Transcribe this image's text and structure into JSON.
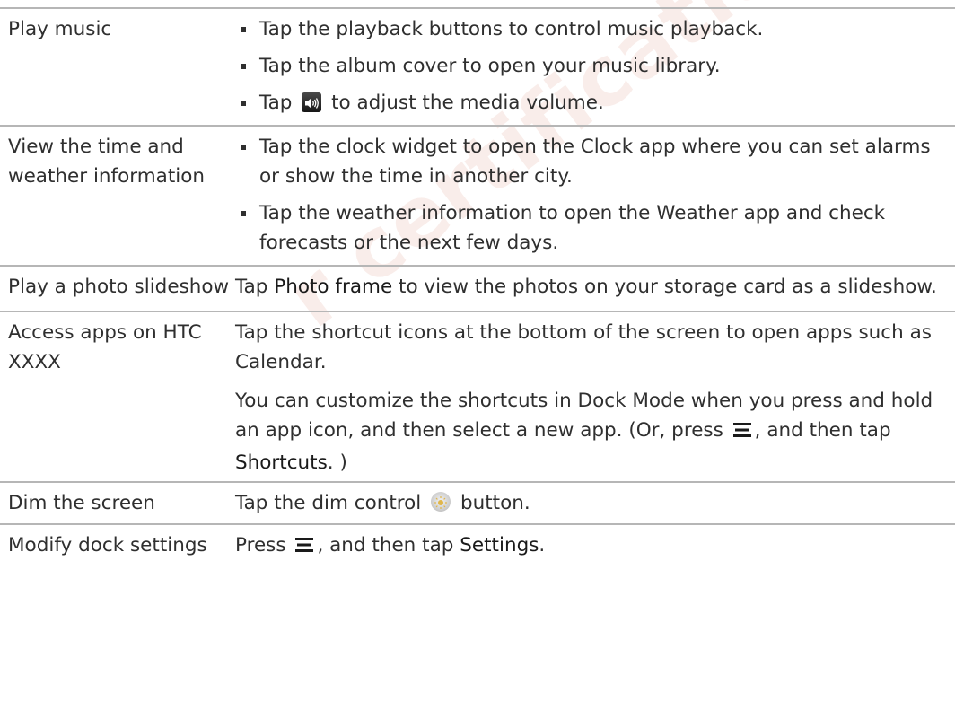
{
  "rows": [
    {
      "action": "Play music",
      "bullets": [
        "Tap the playback buttons to control music playback.",
        "Tap the album cover to open your music library.",
        {
          "before": "Tap",
          "icon": "speaker-volume-icon",
          "after": "to adjust the media volume."
        }
      ]
    },
    {
      "action": "View the time and weather information",
      "bullets": [
        "Tap the clock widget to open the Clock app where you can set alarms or show the time in another city.",
        "Tap the weather information to open the Weather app and check forecasts or the next few days."
      ]
    },
    {
      "action": "Play a photo slideshow",
      "desc": {
        "before": "Tap",
        "term": "Photo frame",
        "after": "to view the photos on your storage card as a slideshow."
      }
    },
    {
      "action": "Access apps on HTC XXXX",
      "paragraphs": [
        "Tap the shortcut icons at the bottom of the screen to open apps such as Calendar.",
        "You can customize the shortcuts in Dock Mode when you press and hold an app icon, and then select a new app."
      ],
      "note": {
        "before": "(Or, press",
        "icon": "menu-icon",
        "middle": ", and then tap",
        "term": "Shortcuts",
        "after": ". )"
      }
    },
    {
      "action": "Dim the screen",
      "desc": {
        "before": "Tap the dim control",
        "icon": "brightness-icon",
        "after": "button."
      }
    },
    {
      "action": "Modify dock settings",
      "desc": {
        "before": "Press",
        "icon": "menu-icon",
        "middle": ", and then tap",
        "term": "Settings",
        "after": "."
      }
    }
  ],
  "watermark": "r certification re",
  "colors": {
    "text": "#2f2f2f",
    "rule": "#b6b6b6",
    "watermark": "#e8beb2"
  }
}
